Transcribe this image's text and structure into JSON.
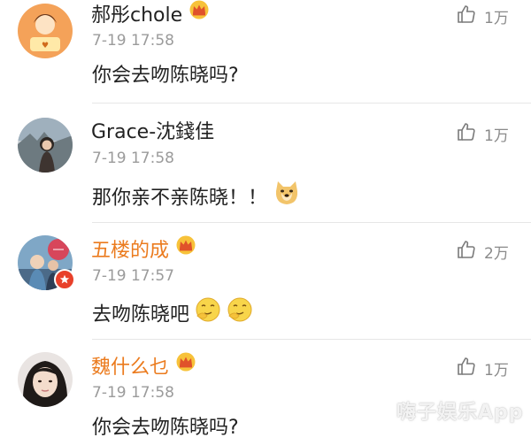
{
  "comments": [
    {
      "username": "郝彤chole",
      "time": "7-19 17:58",
      "text": "你会去吻陈晓吗?",
      "likes": "1万",
      "name_color": "#222222"
    },
    {
      "username": "Grace-沈錢佳",
      "time": "7-19 17:58",
      "text": "那你亲不亲陈晓！！",
      "likes": "1万",
      "name_color": "#222222"
    },
    {
      "username": "五楼的成",
      "time": "7-19 17:57",
      "text": "去吻陈晓吧",
      "likes": "2万",
      "name_color": "#eb7b1e"
    },
    {
      "username": "魏什么乜",
      "time": "7-19 17:58",
      "text": "你会去吻陈晓吗?",
      "likes": "1万",
      "name_color": "#eb7b1e"
    }
  ],
  "watermark": "嗨子娱乐App",
  "icons": {
    "like": "thumbs-up-icon",
    "crown": "vip-crown-icon",
    "verified": "verified-badge-icon"
  }
}
